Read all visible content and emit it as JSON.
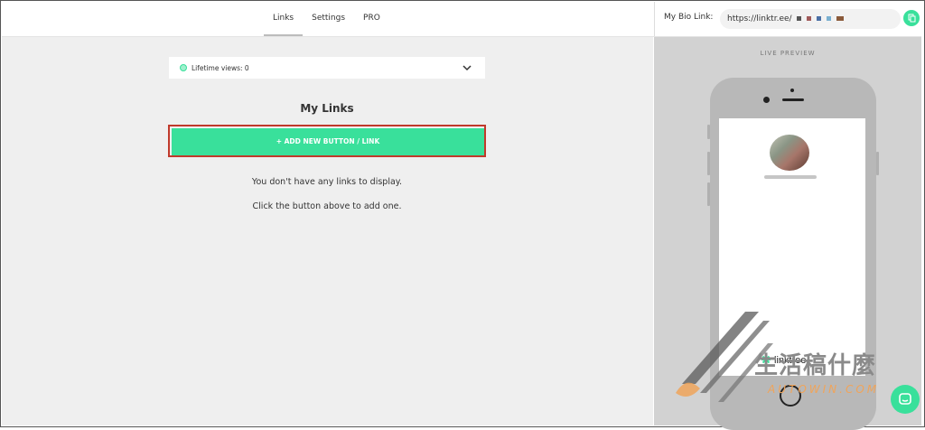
{
  "nav": {
    "links": "Links",
    "settings": "Settings",
    "pro": "PRO"
  },
  "bio": {
    "label": "My Bio Link:",
    "url": "https://linktr.ee/"
  },
  "views": {
    "text": "Lifetime views: 0"
  },
  "main": {
    "title": "My Links",
    "add_button": "+ ADD NEW BUTTON / LINK",
    "empty_line1": "You don't have any links to display.",
    "empty_line2": "Click the button above to add one."
  },
  "preview": {
    "label": "LIVE PREVIEW",
    "brand": "linktree"
  },
  "watermark": {
    "text": "生活稿什麼",
    "url": "AUTOWIN.COM"
  },
  "colors": {
    "accent": "#39e09b",
    "highlight": "#c0392b",
    "panel": "#efefef",
    "preview_bg": "#d2d2d2"
  },
  "icons": [
    "status-dot-icon",
    "chevron-down-icon",
    "copy-icon",
    "linktree-logo-icon",
    "chat-icon"
  ]
}
